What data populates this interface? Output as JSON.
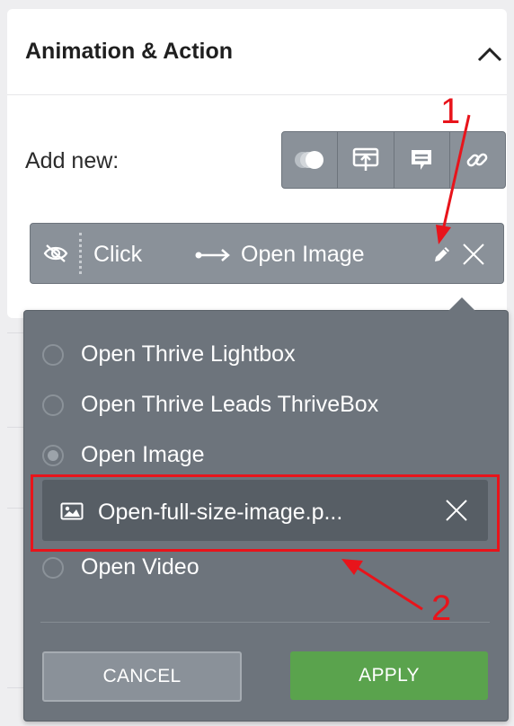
{
  "panel": {
    "title": "Animation & Action",
    "add_new_label": "Add new:",
    "toolbar": [
      {
        "name": "animation-icon"
      },
      {
        "name": "tooltip-icon"
      },
      {
        "name": "popup-icon"
      },
      {
        "name": "link-icon"
      }
    ]
  },
  "action_row": {
    "trigger": "Click",
    "action": "Open Image"
  },
  "popup": {
    "options": [
      {
        "label": "Open Thrive Lightbox",
        "checked": false
      },
      {
        "label": "Open Thrive Leads ThriveBox",
        "checked": false
      },
      {
        "label": "Open Image",
        "checked": true
      },
      {
        "label": "Open Video",
        "checked": false
      }
    ],
    "selected_file": "Open-full-size-image.p...",
    "cancel_label": "CANCEL",
    "apply_label": "APPLY"
  },
  "annotations": {
    "one": "1",
    "two": "2",
    "color": "#e8141b"
  },
  "colors": {
    "accent_green": "#5aa34d",
    "gray_button": "#8a9199",
    "popup_bg": "#6d747c"
  }
}
